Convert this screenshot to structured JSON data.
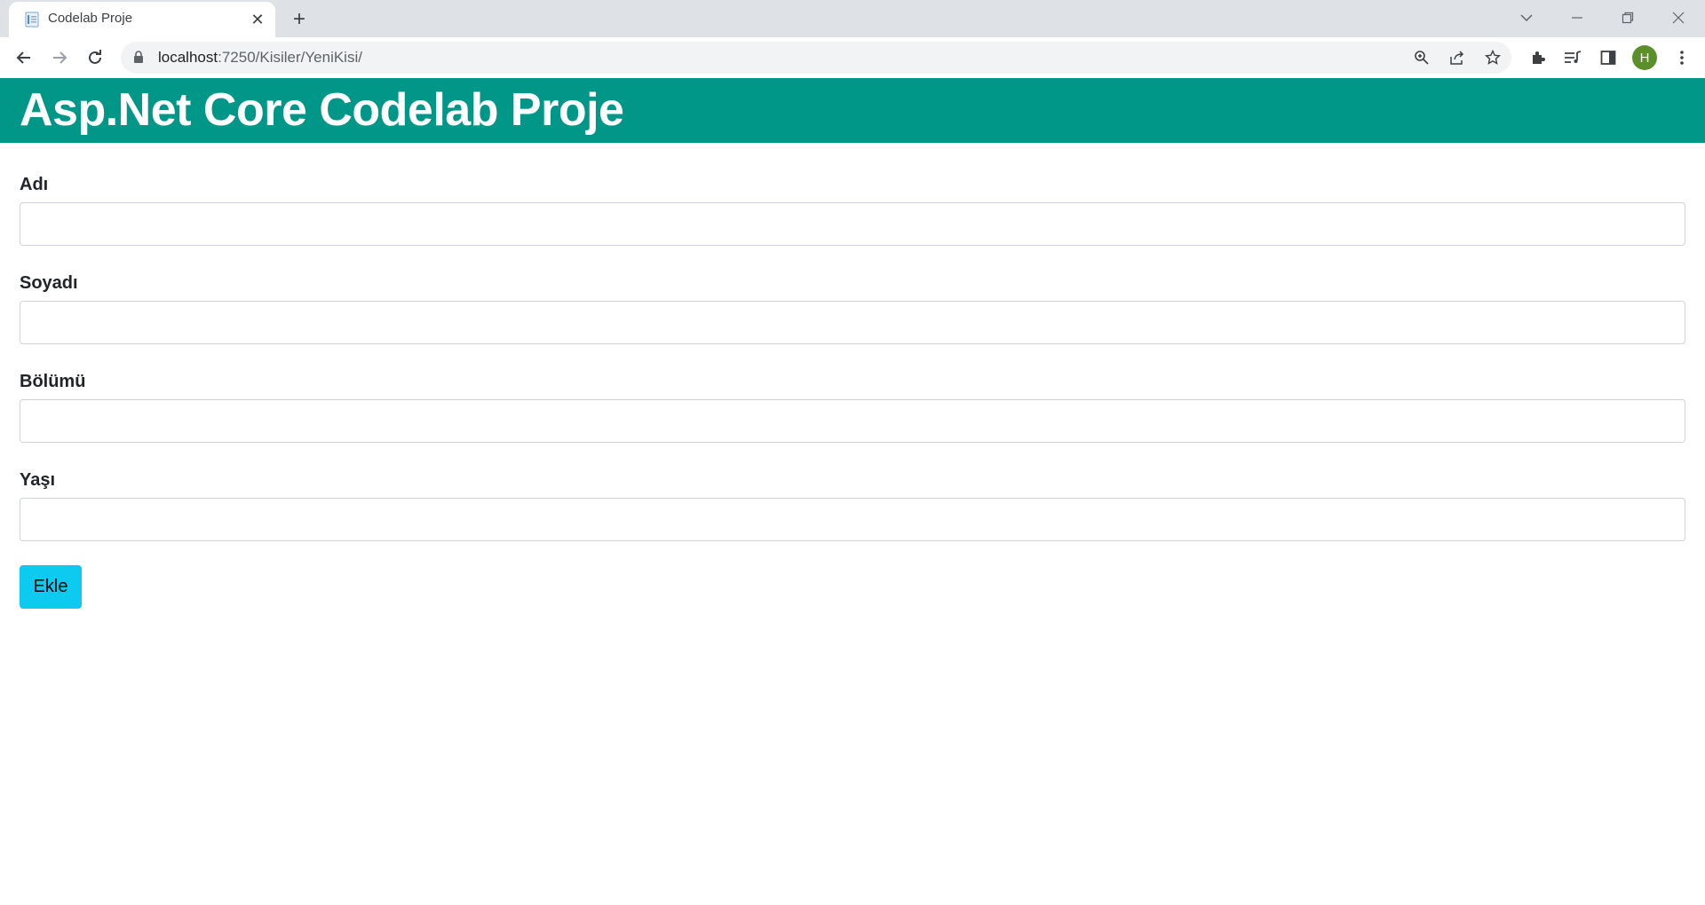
{
  "browser": {
    "tab": {
      "title": "Codelab Proje"
    },
    "address": {
      "host": "localhost",
      "path": ":7250/Kisiler/YeniKisi/"
    },
    "profile_initial": "H"
  },
  "site": {
    "title": "Asp.Net Core Codelab Proje"
  },
  "form": {
    "fields": [
      {
        "label": "Adı",
        "value": ""
      },
      {
        "label": "Soyadı",
        "value": ""
      },
      {
        "label": "Bölümü",
        "value": ""
      },
      {
        "label": "Yaşı",
        "value": ""
      }
    ],
    "submit_label": "Ekle"
  },
  "colors": {
    "header_bg": "#009688",
    "button_bg": "#0dcaf0",
    "tabbar_bg": "#dee1e6"
  }
}
